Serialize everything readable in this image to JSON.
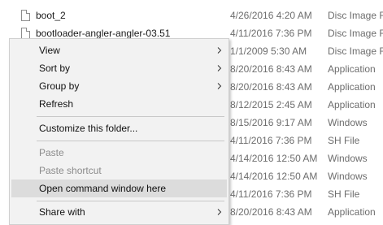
{
  "files": [
    {
      "name": "boot_2",
      "date": "4/26/2016 4:20 AM",
      "type": "Disc Image File"
    },
    {
      "name": "bootloader-angler-angler-03.51",
      "date": "4/11/2016 7:36 PM",
      "type": "Disc Image File"
    },
    {
      "name": "",
      "date": "1/1/2009 5:30 AM",
      "type": "Disc Image File"
    },
    {
      "name": "",
      "date": "8/20/2016 8:43 AM",
      "type": "Application"
    },
    {
      "name": "",
      "date": "8/20/2016 8:43 AM",
      "type": "Application"
    },
    {
      "name": "",
      "date": "8/12/2015 2:45 AM",
      "type": "Application"
    },
    {
      "name": "",
      "date": "8/15/2016 9:17 AM",
      "type": "Windows"
    },
    {
      "name": "",
      "date": "4/11/2016 7:36 PM",
      "type": "SH File"
    },
    {
      "name": "",
      "date": "4/14/2016 12:50 AM",
      "type": "Windows"
    },
    {
      "name": "",
      "date": "4/14/2016 12:50 AM",
      "type": "Windows"
    },
    {
      "name": "",
      "date": "4/11/2016 7:36 PM",
      "type": "SH File"
    },
    {
      "name": "",
      "date": "8/20/2016 8:43 AM",
      "type": "Application"
    }
  ],
  "context_menu": {
    "view": "View",
    "sort_by": "Sort by",
    "group_by": "Group by",
    "refresh": "Refresh",
    "customize": "Customize this folder...",
    "paste": "Paste",
    "paste_shortcut": "Paste shortcut",
    "open_command": "Open command window here",
    "share_with": "Share with"
  },
  "colors": {
    "menu_background": "#f2f2f2",
    "menu_highlight": "#dcdcdc",
    "disabled_text": "#8b8b8b",
    "detail_text": "#6d6d6d"
  }
}
